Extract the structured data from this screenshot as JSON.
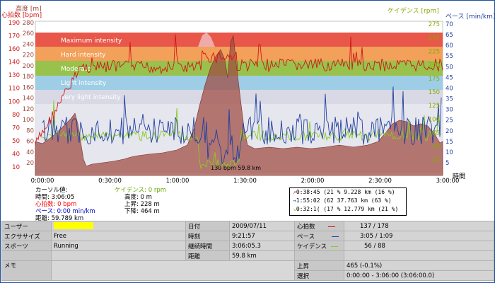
{
  "chart": {
    "label_altitude": "高度 [m]",
    "label_hr": "心拍数 [bpm]",
    "label_cadence": "ケイデンス [rpm]",
    "label_pace": "ペース [min/km]",
    "label_time": "時間",
    "hr_ticks": [
      "190",
      "170",
      "160",
      "140",
      "130",
      "110",
      "100",
      "80",
      "70",
      "50",
      "40",
      "10"
    ],
    "alt_ticks": [
      "280",
      "260",
      "240",
      "220",
      "200",
      "180",
      "160",
      "140",
      "120",
      "100",
      "80",
      "60",
      "40",
      "20"
    ],
    "cad_ticks": [
      "275",
      "250",
      "225",
      "200",
      "175",
      "150",
      "125",
      "100",
      "75",
      "50",
      "25"
    ],
    "pace_ticks": [
      "70",
      "65",
      "60",
      "55",
      "50",
      "45",
      "40",
      "35",
      "30",
      "25",
      "20",
      "15",
      "10",
      "5"
    ],
    "time_ticks": [
      "0:00:00",
      "0:30:00",
      "1:00:00",
      "1:30:00",
      "2:00:00",
      "2:30:00",
      "3:00:00"
    ],
    "zones": [
      "Maximum intensity",
      "Hard intensity",
      "Moderate",
      "Light intensity",
      "Very light intensity"
    ],
    "zone_colors": [
      "#e8574a",
      "#f2a05a",
      "#98c24c",
      "#9ecde6",
      "#d9d9e6"
    ],
    "cursor_readout": "130 bpm  59.8 km"
  },
  "cursor": {
    "title": "カーソル値:",
    "time": "時間: 3:06:05",
    "hr": "心拍数: 0 bpm",
    "pace": "ペース: 0:00 min/km",
    "distance": "距離: 59.789 km"
  },
  "cadence_panel": {
    "cadence": "ケイデンス: 0 rpm",
    "altitude": "高度: 0 m",
    "ascent": "上昇: 228 m",
    "descent": "下降: 464 m"
  },
  "zone_summary": [
    "0:38:45 (21 %  9.228 km  (16 %)",
    "1:55:02 (62   37.763 km  (63 %)",
    "0:32:1( (17 % 12.779 km  (21 %)"
  ],
  "info": {
    "user_label": "ユーザー",
    "exercise_label": "エクササイズ",
    "exercise_value": "Free",
    "sport_label": "スポーツ",
    "sport_value": "Running",
    "memo_label": "メモ",
    "date_label": "日付",
    "date_value": "2009/07/11",
    "time_label": "時刻",
    "time_value": "9:21:57",
    "duration_label": "継続時間",
    "duration_value": "3:06:05.3",
    "distance_label": "距離",
    "distance_value": "59.8 km",
    "hr_label": "心拍数",
    "hr_value": "137 / 178",
    "pace_label": "ペース",
    "pace_value": "3:05 / 1:09",
    "cadence_label": "ケイデンス",
    "cadence_value": "56 / 88",
    "ascent_label": "上昇",
    "ascent_value": "465 (-0.1%)",
    "selection_label": "選択",
    "selection_value": "0:00:00 - 3:06:00 (3:06:00.0)"
  }
}
